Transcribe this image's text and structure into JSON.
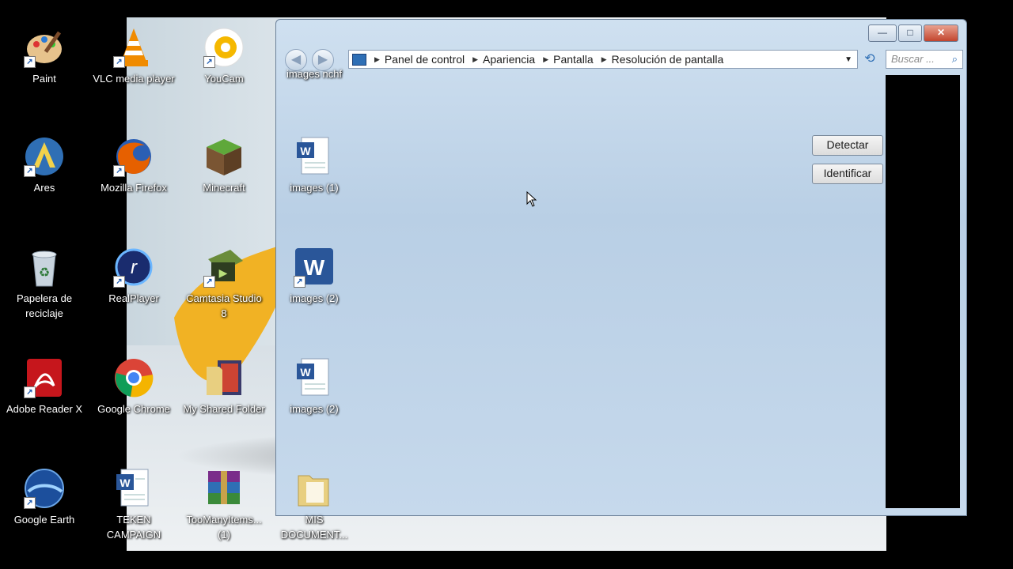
{
  "desktop_icons": [
    {
      "label": "Paint",
      "icon": "paint-icon"
    },
    {
      "label": "VLC media player",
      "icon": "vlc-icon"
    },
    {
      "label": "YouCam",
      "icon": "youcam-icon"
    },
    {
      "label": "Ares",
      "icon": "ares-icon"
    },
    {
      "label": "Mozilla Firefox",
      "icon": "firefox-icon"
    },
    {
      "label": "Minecraft",
      "icon": "minecraft-icon"
    },
    {
      "label": "Papelera de\nreciclaje",
      "icon": "recycle-bin-icon"
    },
    {
      "label": "RealPlayer",
      "icon": "realplayer-icon"
    },
    {
      "label": "Camtasia Studio\n8",
      "icon": "camtasia-icon"
    },
    {
      "label": "Adobe Reader X",
      "icon": "adobe-reader-icon"
    },
    {
      "label": "Google Chrome",
      "icon": "chrome-icon"
    },
    {
      "label": "My Shared Folder",
      "icon": "shared-folder-icon"
    },
    {
      "label": "Google Earth",
      "icon": "google-earth-icon"
    },
    {
      "label": "TEKEN\nCAMPAIGN",
      "icon": "word-document-icon"
    },
    {
      "label": "TooManyItems...\n(1)",
      "icon": "winrar-icon"
    },
    {
      "label": "images nchf",
      "icon": "word-document-icon"
    },
    {
      "label": "images (1)",
      "icon": "word-document-icon"
    },
    {
      "label": "images (2)",
      "icon": "word-shortcut-icon"
    },
    {
      "label": "images (2)",
      "icon": "word-document-icon"
    },
    {
      "label": "MIS\nDOCUMENT...",
      "icon": "folder-icon"
    }
  ],
  "window": {
    "title_buttons": {
      "minimize": "—",
      "maximize": "□",
      "close": "✕"
    },
    "breadcrumb": [
      "Panel de control",
      "Apariencia",
      "Pantalla",
      "Resolución de pantalla"
    ],
    "search_placeholder": "Buscar ...",
    "buttons": {
      "detect": "Detectar",
      "identify": "Identificar"
    }
  },
  "colors": {
    "accent": "#c2452e",
    "car": "#f6b400"
  }
}
